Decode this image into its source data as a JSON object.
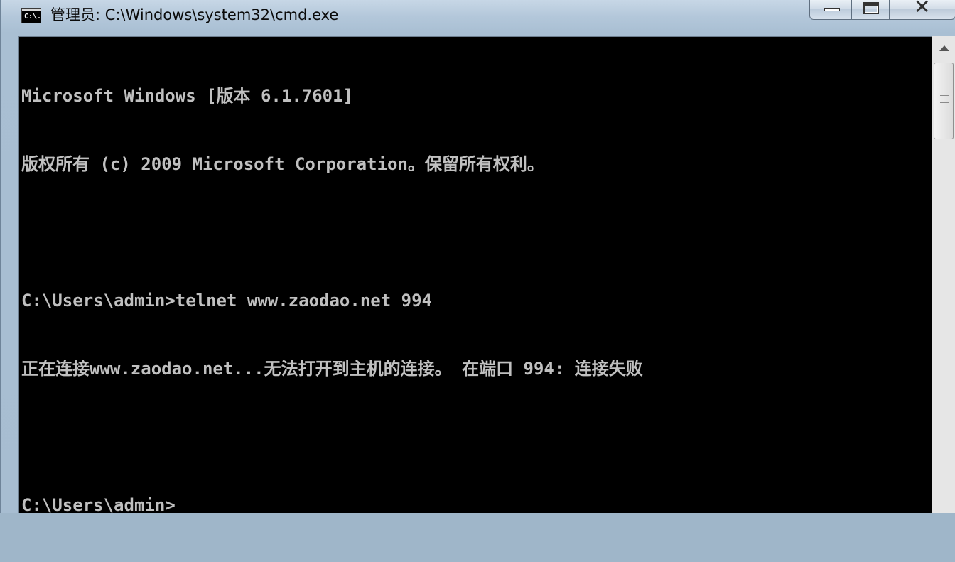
{
  "window": {
    "title": "管理员: C:\\Windows\\system32\\cmd.exe",
    "icon_text": "C:\\."
  },
  "caption_buttons": {
    "minimize_icon": "minimize-icon",
    "maximize_icon": "maximize-icon",
    "close_glyph": "✕"
  },
  "console": {
    "lines": [
      "Microsoft Windows [版本 6.1.7601]",
      "版权所有 (c) 2009 Microsoft Corporation。保留所有权利。",
      "",
      "C:\\Users\\admin>telnet www.zaodao.net 994",
      "正在连接www.zaodao.net...无法打开到主机的连接。 在端口 994: 连接失败",
      "",
      "C:\\Users\\admin>"
    ]
  },
  "colors": {
    "console_bg": "#000000",
    "console_text": "#c0c0c0",
    "frame": "#a9bfd3"
  }
}
